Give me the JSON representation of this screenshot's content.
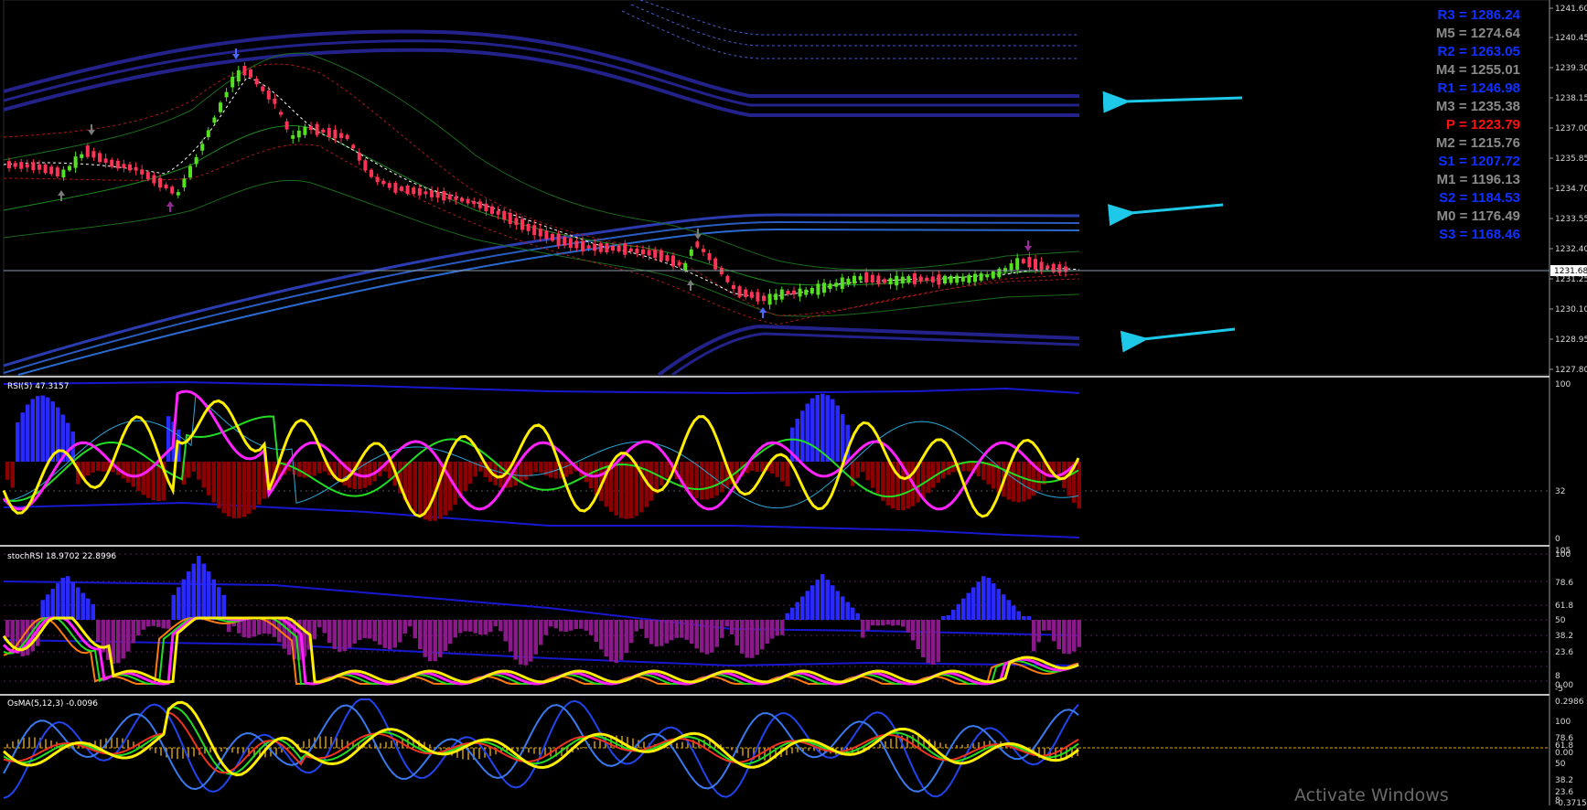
{
  "colors": {
    "background": "#000000",
    "bull_candle": "#55e020",
    "bear_candle": "#ff3355",
    "pivot_blue": "#1030ff",
    "pivot_gray": "#8a8a8a",
    "pivot_red": "#ff1010",
    "arrow_cyan": "#1ec8e8",
    "rsi_fast": "#ffee00",
    "hist_up": "#2a2aff",
    "hist_down": "#8b0000",
    "stoch_hist_down": "#8a1a8a"
  },
  "main": {
    "price_axis_ticks": [
      "1241.60",
      "1240.45",
      "1239.30",
      "1238.15",
      "1237.00",
      "1235.85",
      "1234.70",
      "1233.55",
      "1232.40",
      "1231.25",
      "1230.10",
      "1228.95",
      "1227.80"
    ],
    "current_price": "1231.68",
    "pivots": [
      {
        "label": "R3 = 1286.24",
        "color": "#1030ff"
      },
      {
        "label": "M5 = 1274.64",
        "color": "#8a8a8a"
      },
      {
        "label": "R2 = 1263.05",
        "color": "#1030ff"
      },
      {
        "label": "M4 = 1255.01",
        "color": "#8a8a8a"
      },
      {
        "label": "R1 = 1246.98",
        "color": "#1030ff"
      },
      {
        "label": "M3 = 1235.38",
        "color": "#8a8a8a"
      },
      {
        "label": "P   = 1223.79",
        "color": "#ff1010"
      },
      {
        "label": "M2 = 1215.76",
        "color": "#8a8a8a"
      },
      {
        "label": "S1 = 1207.72",
        "color": "#1030ff"
      },
      {
        "label": "M1 = 1196.13",
        "color": "#8a8a8a"
      },
      {
        "label": "S2 = 1184.53",
        "color": "#1030ff"
      },
      {
        "label": "M0 = 1176.49",
        "color": "#8a8a8a"
      },
      {
        "label": "S3 = 1168.46",
        "color": "#1030ff"
      }
    ],
    "arrows": [
      "cyan-arrow-upper",
      "cyan-arrow-middle",
      "cyan-arrow-lower"
    ]
  },
  "rsi_panel": {
    "label": "RSI(5) 47.3157",
    "axis_ticks": [
      "100",
      "32",
      "0"
    ]
  },
  "stoch_panel": {
    "label": "stochRSI 18.9702 22.8996",
    "axis_ticks": [
      "105",
      "100",
      "78.6",
      "61.8",
      "50",
      "38.2",
      "23.6",
      "8",
      "0.00",
      "-5"
    ]
  },
  "osma_panel": {
    "label": "OsMA(5,12,3) -0.0096",
    "axis_ticks": [
      "0.2986",
      "100",
      "78.6",
      "61.8",
      "0.00",
      "50",
      "38.2",
      "23.6",
      "8",
      "-0.3715"
    ]
  },
  "watermark": "Activate Windows"
}
